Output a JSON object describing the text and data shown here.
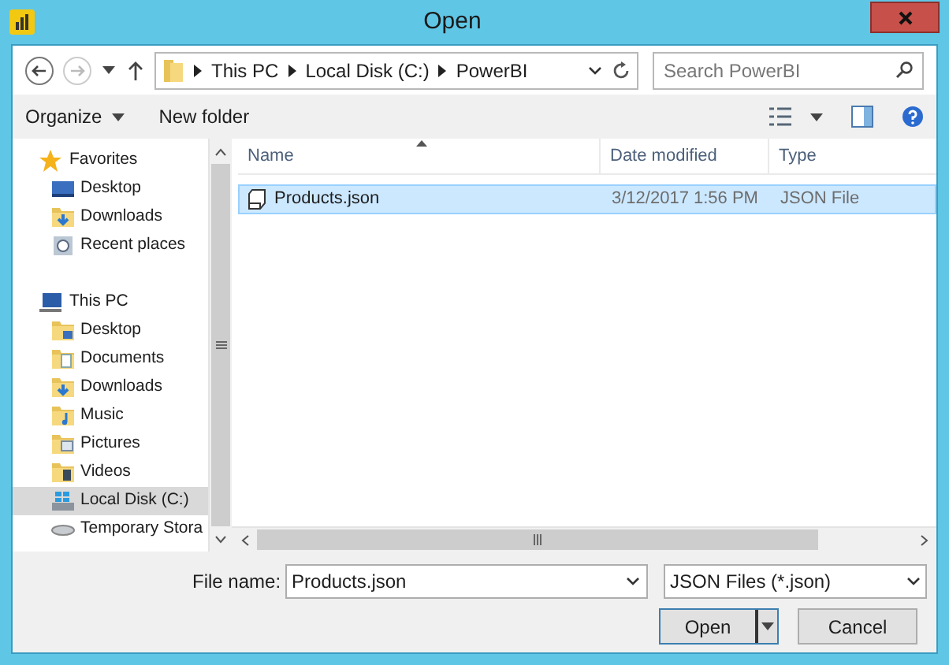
{
  "window": {
    "title": "Open"
  },
  "address": {
    "path": [
      "This PC",
      "Local Disk (C:)",
      "PowerBI"
    ]
  },
  "search": {
    "placeholder": "Search PowerBI"
  },
  "toolbar": {
    "buttons": [
      "Organize",
      "New folder"
    ]
  },
  "sidebar": {
    "groups": [
      {
        "label": "Favorites",
        "selected": false,
        "children": [
          {
            "label": "Desktop",
            "selected": false
          },
          {
            "label": "Downloads",
            "selected": false
          },
          {
            "label": "Recent places",
            "selected": false
          }
        ]
      },
      {
        "label": "This PC",
        "selected": false,
        "children": [
          {
            "label": "Desktop",
            "selected": false
          },
          {
            "label": "Documents",
            "selected": false
          },
          {
            "label": "Downloads",
            "selected": false
          },
          {
            "label": "Music",
            "selected": false
          },
          {
            "label": "Pictures",
            "selected": false
          },
          {
            "label": "Videos",
            "selected": false
          },
          {
            "label": "Local Disk (C:)",
            "selected": true
          },
          {
            "label": "Temporary Stora",
            "selected": false
          }
        ]
      }
    ]
  },
  "table": {
    "columns": [
      "Name",
      "Date modified",
      "Type"
    ],
    "rows": [
      {
        "name": "Products.json",
        "date": "3/12/2017 1:56 PM",
        "type": "JSON File",
        "selected": true
      }
    ]
  },
  "file_name": {
    "label": "File name:",
    "value": "Products.json"
  },
  "file_type": {
    "value": "JSON Files (*.json)"
  },
  "buttons": [
    "Open",
    "Cancel"
  ]
}
